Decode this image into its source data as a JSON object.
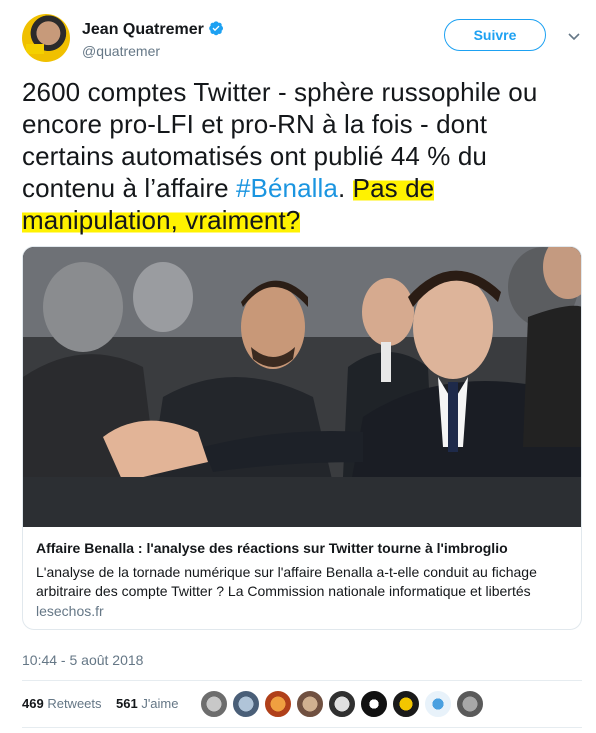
{
  "author": {
    "name": "Jean Quatremer",
    "handle": "@quatremer",
    "follow_label": "Suivre"
  },
  "tweet": {
    "text_plain": "2600 comptes Twitter - sphère russophile ou encore pro-LFI et pro-RN à la fois - dont certains automatisés ont publié 44 % du contenu à l’affaire ",
    "hashtag": "#Bénalla",
    "text_after_hashtag": ". ",
    "highlighted": "Pas de manipulation, vraiment?"
  },
  "card": {
    "title": "Affaire Benalla : l'analyse des réactions sur Twitter tourne à l'imbroglio",
    "description": "L'analyse de la tornade numérique sur  l'affaire Benalla a-t-elle conduit au fichage arbitraire des compte Twitter ? La Commission nationale informatique et libertés",
    "domain": "lesechos.fr"
  },
  "meta": {
    "timestamp": "10:44 - 5 août 2018",
    "retweets_count": "469",
    "retweets_label": "Retweets",
    "likes_count": "561",
    "likes_label": "J'aime"
  },
  "colors": {
    "accent": "#1da1f2",
    "hashtag": "#1b95e0",
    "highlight": "#fff200",
    "secondary_text": "#657786"
  }
}
